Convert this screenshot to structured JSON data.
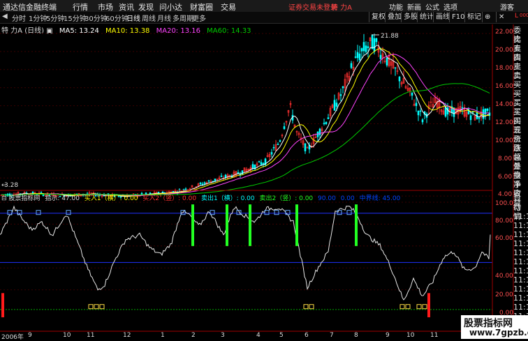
{
  "titlebar": {
    "app": "通达信金融终端",
    "menu": [
      "行情",
      "市场",
      "资讯",
      "发现",
      "问小达",
      "财富圈",
      "交易"
    ],
    "warning": "证券交易未登录",
    "stock": "特 力A",
    "right": [
      "功能",
      "新画",
      "公式",
      "选项"
    ],
    "user": "游客"
  },
  "toolbar": {
    "tabs": [
      "分时",
      "1分钟",
      "5分钟",
      "15分钟",
      "30分钟",
      "60分钟",
      "日线",
      "周线",
      "月线",
      "多周期",
      "更多"
    ],
    "active": "日线",
    "buttons": [
      "复权",
      "叠加",
      "多股",
      "统计",
      "画线",
      "F10",
      "标记"
    ]
  },
  "main": {
    "name": "特 力A (日线)",
    "ma5": "MA5: 13.24",
    "ma10": "MA10: 13.38",
    "ma20": "MA20: 13.16",
    "ma60": "MA60: 14.33",
    "peak": "21.88",
    "low": "3.28",
    "yaxis": [
      "22.00",
      "20.00",
      "18.00",
      "16.00",
      "14.00",
      "12.00",
      "10.00",
      "8.00",
      "6.00",
      "4.00"
    ]
  },
  "side_labels": [
    "委比",
    "卖五",
    "卖四",
    "卖三",
    "卖二",
    "卖一",
    "买一",
    "买二",
    "买三",
    "买四",
    "买五",
    "现价",
    "涨跌",
    "涨幅",
    "总量",
    "外盘",
    "换手",
    "净资",
    "收益"
  ],
  "sub": {
    "name": "股票指标网",
    "indicator": "指示: 47.00",
    "buy1": "买入1（横）: 0.00",
    "buy2": "买入2（竖）: 0.00",
    "sell1": "卖出1（横）: 0.00",
    "sell2": "卖出2（竖）: 0.00",
    "v90": "90.00",
    "v0": "0.00",
    "mid": "中界线: 45.00",
    "yaxis": [
      "100.0",
      "80.00",
      "60.00",
      "40.00",
      "20.00",
      "0.00"
    ]
  },
  "sub_side": [
    "自动",
    "行情",
    "11:1",
    "11:1",
    "11:1",
    "11:1",
    "11:1",
    "11:1",
    "11:1",
    "11:1",
    "11:1",
    "11:1",
    "11:1",
    "11:1"
  ],
  "dates": [
    "2006年",
    "9",
    "10",
    "11",
    "12",
    "1",
    "2",
    "3",
    "4",
    "5",
    "6",
    "7",
    "8",
    "9",
    "10",
    "11"
  ],
  "watermark": {
    "line1": "股票指标网",
    "line2": "www.7gpzb.com"
  },
  "colors": {
    "ma5": "#ffffff",
    "ma10": "#ffff00",
    "ma20": "#ff44ff",
    "ma60": "#00cc00",
    "up": "#ff3030",
    "down": "#00ffff",
    "signal_green": "#22ff22",
    "signal_red": "#ff1a1a"
  }
}
